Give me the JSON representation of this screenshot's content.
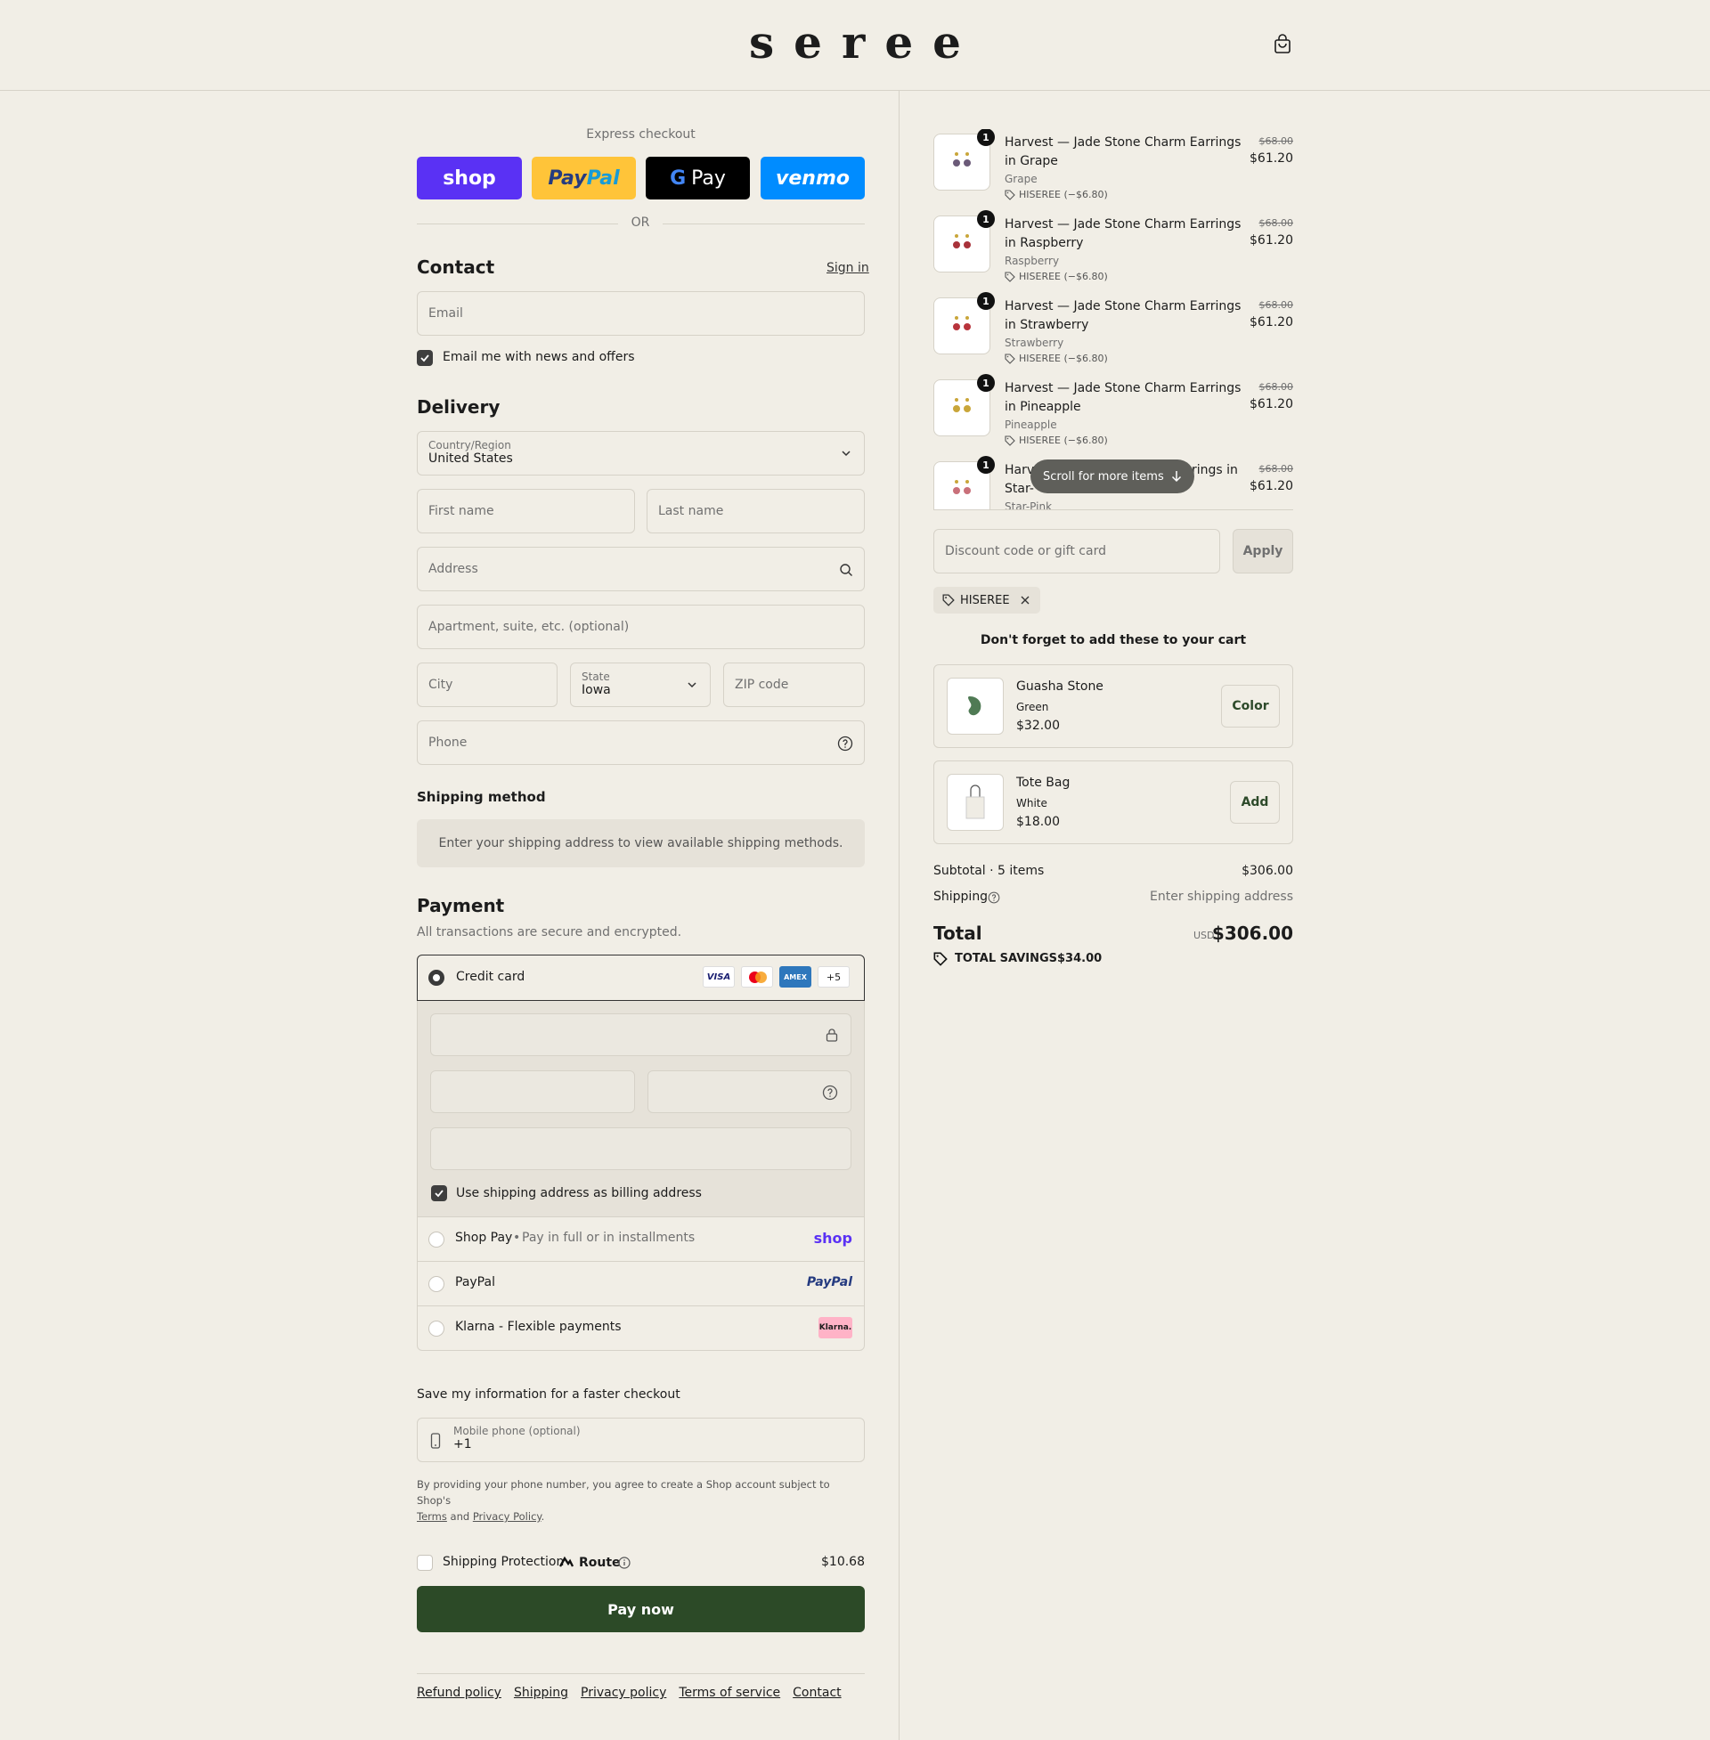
{
  "header": {
    "logo": "seree"
  },
  "express": {
    "title": "Express checkout",
    "or": "OR",
    "shop": "shop",
    "paypal_pay": "Pay",
    "paypal_pal": "Pal",
    "gpay": "Pay",
    "venmo": "venmo"
  },
  "contact": {
    "title": "Contact",
    "sign_in": "Sign in",
    "email_placeholder": "Email",
    "news_label": "Email me with news and offers"
  },
  "delivery": {
    "title": "Delivery",
    "country_label": "Country/Region",
    "country_value": "United States",
    "first_name": "First name",
    "last_name": "Last name",
    "address": "Address",
    "apartment": "Apartment, suite, etc. (optional)",
    "city": "City",
    "state_label": "State",
    "state_value": "Iowa",
    "zip": "ZIP code",
    "phone": "Phone"
  },
  "shipping_method": {
    "title": "Shipping method",
    "message": "Enter your shipping address to view available shipping methods."
  },
  "payment": {
    "title": "Payment",
    "subtitle": "All transactions are secure and encrypted.",
    "credit_card": "Credit card",
    "visa": "VISA",
    "amex": "AMEX",
    "more_cards": "+5",
    "billing_label": "Use shipping address as billing address",
    "shop_pay": "Shop Pay",
    "shop_pay_desc": "Pay in full or in installments",
    "shop_pay_logo": "shop",
    "paypal": "PayPal",
    "paypal_logo": "PayPal",
    "klarna": "Klarna - Flexible payments",
    "klarna_logo": "Klarna."
  },
  "save_info": {
    "title": "Save my information for a faster checkout",
    "mobile_label": "Mobile phone (optional)",
    "mobile_value": "+1",
    "legal_1": "By providing your phone number, you agree to create a Shop account subject to Shop's",
    "terms": "Terms",
    "and": "and",
    "privacy": "Privacy Policy",
    "period": "."
  },
  "protection": {
    "label": "Shipping Protection",
    "brand": "Route",
    "price": "$10.68"
  },
  "pay_now": "Pay now",
  "footer": [
    "Refund policy",
    "Shipping",
    "Privacy policy",
    "Terms of service",
    "Contact"
  ],
  "cart": {
    "items": [
      {
        "name": "Harvest — Jade Stone Charm Earrings in Grape",
        "variant": "Grape",
        "discount": "HISEREE (−$6.80)",
        "original": "$68.00",
        "price": "$61.20",
        "qty": "1",
        "color": "#6b5a78"
      },
      {
        "name": "Harvest — Jade Stone Charm Earrings in Raspberry",
        "variant": "Raspberry",
        "discount": "HISEREE (−$6.80)",
        "original": "$68.00",
        "price": "$61.20",
        "qty": "1",
        "color": "#a8323a"
      },
      {
        "name": "Harvest — Jade Stone Charm Earrings in Strawberry",
        "variant": "Strawberry",
        "discount": "HISEREE (−$6.80)",
        "original": "$68.00",
        "price": "$61.20",
        "qty": "1",
        "color": "#b8343c"
      },
      {
        "name": "Harvest — Jade Stone Charm Earrings in Pineapple",
        "variant": "Pineapple",
        "discount": "HISEREE (−$6.80)",
        "original": "$68.00",
        "price": "$61.20",
        "qty": "1",
        "color": "#c9a63a"
      },
      {
        "name_start": "Harv",
        "name_end": "rings in",
        "name_line2": "Star-",
        "variant": "Star-Pink",
        "original": "$68.00",
        "price": "$61.20",
        "qty": "1",
        "color": "#c9707a"
      }
    ],
    "scroll_hint": "Scroll for more items",
    "discount_placeholder": "Discount code or gift card",
    "apply": "Apply",
    "code": "HISEREE",
    "upsell_title": "Don't forget to add these to your cart",
    "upsells": [
      {
        "name": "Guasha Stone",
        "variant": "Green",
        "price": "$32.00",
        "button": "Color"
      },
      {
        "name": "Tote Bag",
        "variant": "White",
        "price": "$18.00",
        "button": "Add"
      }
    ],
    "subtotal_label": "Subtotal · 5 items",
    "subtotal_value": "$306.00",
    "shipping_label": "Shipping",
    "shipping_value": "Enter shipping address",
    "total_label": "Total",
    "currency": "USD",
    "total_value": "$306.00",
    "savings_label": "TOTAL SAVINGS",
    "savings_value": "$34.00"
  }
}
